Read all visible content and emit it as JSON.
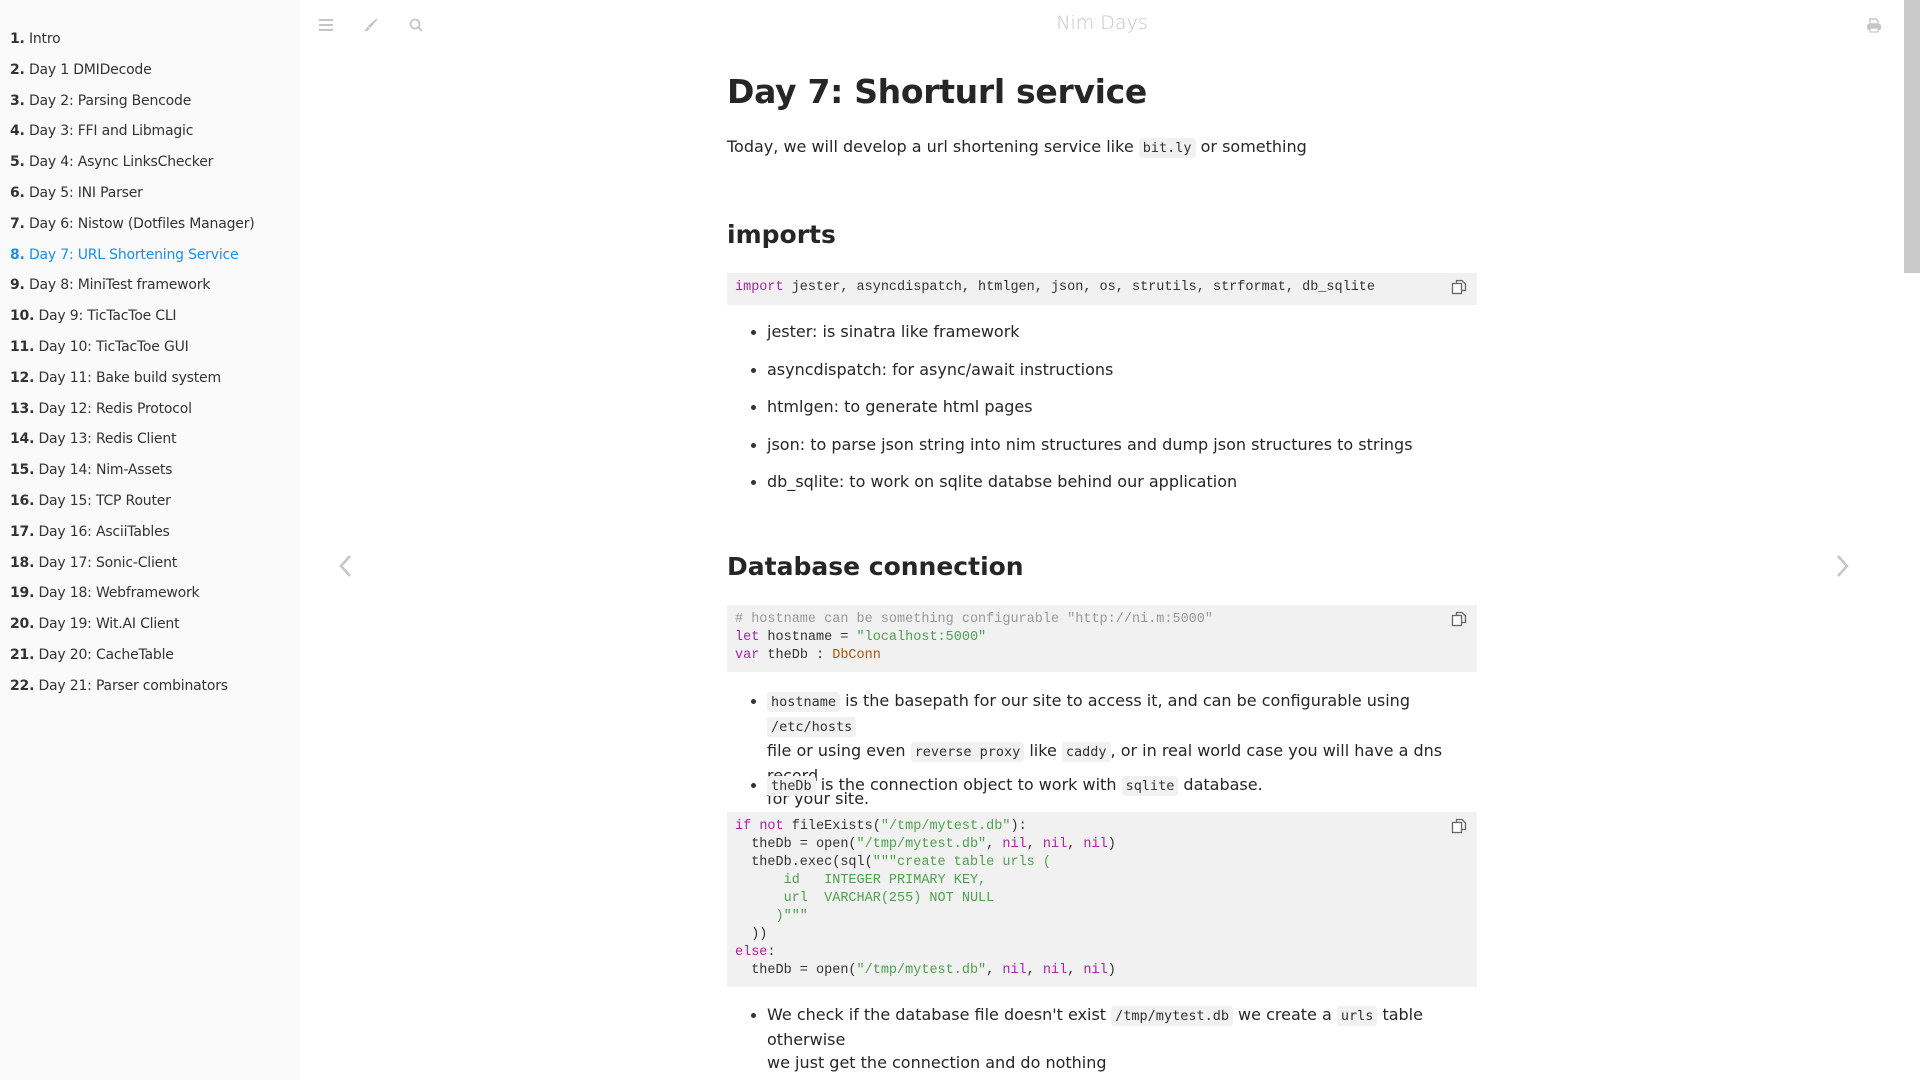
{
  "sidebar": {
    "items": [
      {
        "num": "1.",
        "label": "Intro"
      },
      {
        "num": "2.",
        "label": "Day 1 DMIDecode"
      },
      {
        "num": "3.",
        "label": "Day 2: Parsing Bencode"
      },
      {
        "num": "4.",
        "label": "Day 3: FFI and Libmagic"
      },
      {
        "num": "5.",
        "label": "Day 4: Async LinksChecker"
      },
      {
        "num": "6.",
        "label": "Day 5: INI Parser"
      },
      {
        "num": "7.",
        "label": "Day 6: Nistow (Dotfiles Manager)"
      },
      {
        "num": "8.",
        "label": "Day 7: URL Shortening Service",
        "active": true
      },
      {
        "num": "9.",
        "label": "Day 8: MiniTest framework"
      },
      {
        "num": "10.",
        "label": "Day 9: TicTacToe CLI"
      },
      {
        "num": "11.",
        "label": "Day 10: TicTacToe GUI"
      },
      {
        "num": "12.",
        "label": "Day 11: Bake build system"
      },
      {
        "num": "13.",
        "label": "Day 12: Redis Protocol"
      },
      {
        "num": "14.",
        "label": "Day 13: Redis Client"
      },
      {
        "num": "15.",
        "label": "Day 14: Nim-Assets"
      },
      {
        "num": "16.",
        "label": "Day 15: TCP Router"
      },
      {
        "num": "17.",
        "label": "Day 16: AsciiTables"
      },
      {
        "num": "18.",
        "label": "Day 17: Sonic-Client"
      },
      {
        "num": "19.",
        "label": "Day 18: Webframework"
      },
      {
        "num": "20.",
        "label": "Day 19: Wit.AI Client"
      },
      {
        "num": "21.",
        "label": "Day 20: CacheTable"
      },
      {
        "num": "22.",
        "label": "Day 21: Parser combinators"
      }
    ],
    "active_color": "#1f8ce6"
  },
  "menu": {
    "title": "Nim Days",
    "icons": [
      "menu-icon",
      "theme-brush-icon",
      "search-icon",
      "print-icon"
    ]
  },
  "content": {
    "h1": "Day 7: Shorturl service",
    "intro": {
      "before": "Today, we will develop a url shortening service like ",
      "code": "bit.ly",
      "after": " or something"
    },
    "imports": {
      "heading": "imports",
      "code": {
        "kw": "import",
        "rest": " jester, asyncdispatch, htmlgen, json, os, strutils, strformat, db_sqlite"
      },
      "bullets": [
        "jester: is sinatra like framework",
        "asyncdispatch: for async/await instructions",
        "htmlgen: to generate html pages",
        "json: to parse json string into nim structures and dump json structures to strings",
        "db_sqlite: to work on sqlite databse behind our application"
      ]
    },
    "db": {
      "heading": "Database connection",
      "code1": {
        "comment": "# hostname can be something configurable \"http://ni.m:5000\"",
        "line2_kw": "let",
        "line2_mid": " hostname = ",
        "line2_str": "\"localhost:5000\"",
        "line3_kw": "var",
        "line3_mid": " theDb : ",
        "line3_type": "DbConn"
      },
      "bullet1": {
        "code_a": "hostname",
        "text_a": " is the basepath for our site to access it, and can be configurable using ",
        "code_b": "/etc/hosts",
        "text_b": "file or using even ",
        "code_c": "reverse proxy",
        "text_c": " like ",
        "code_d": "caddy",
        "text_d": ", or in real world case you will have a dns record",
        "text_e": "for your site."
      },
      "bullet2": {
        "code_a": "theDb",
        "text_a": " is the connection object to work with ",
        "code_b": "sqlite",
        "text_b": " database."
      },
      "code2": {
        "l1_kw1": "if",
        "l1_kw2": "not",
        "l1_fn": " fileExists(",
        "l1_str": "\"/tmp/mytest.db\"",
        "l1_end": "):",
        "l2_a": "  theDb = open(",
        "l2_str": "\"/tmp/mytest.db\"",
        "nil": "nil",
        "l3_a": "  theDb.exec(sql(",
        "l3_str": "\"\"\"create table urls (",
        "l4_str": "      id   INTEGER PRIMARY KEY,",
        "l5_str": "      url  VARCHAR(255) NOT NULL",
        "l6_str": "     )\"\"\"",
        "l7": "  ))",
        "l8_kw": "else",
        "l8_end": ":",
        "l9_a": "  theDb = open(",
        "l9_str": "\"/tmp/mytest.db\""
      },
      "bullet3": {
        "text_a": "We check if the database file doesn't exist ",
        "code_a": "/tmp/mytest.db",
        "text_b": " we create a ",
        "code_b": "urls",
        "text_c": " table otherwise",
        "text_d": "we just get the connection and do nothing"
      }
    }
  },
  "nav": {
    "prev": "previous-chapter",
    "next": "next-chapter"
  }
}
